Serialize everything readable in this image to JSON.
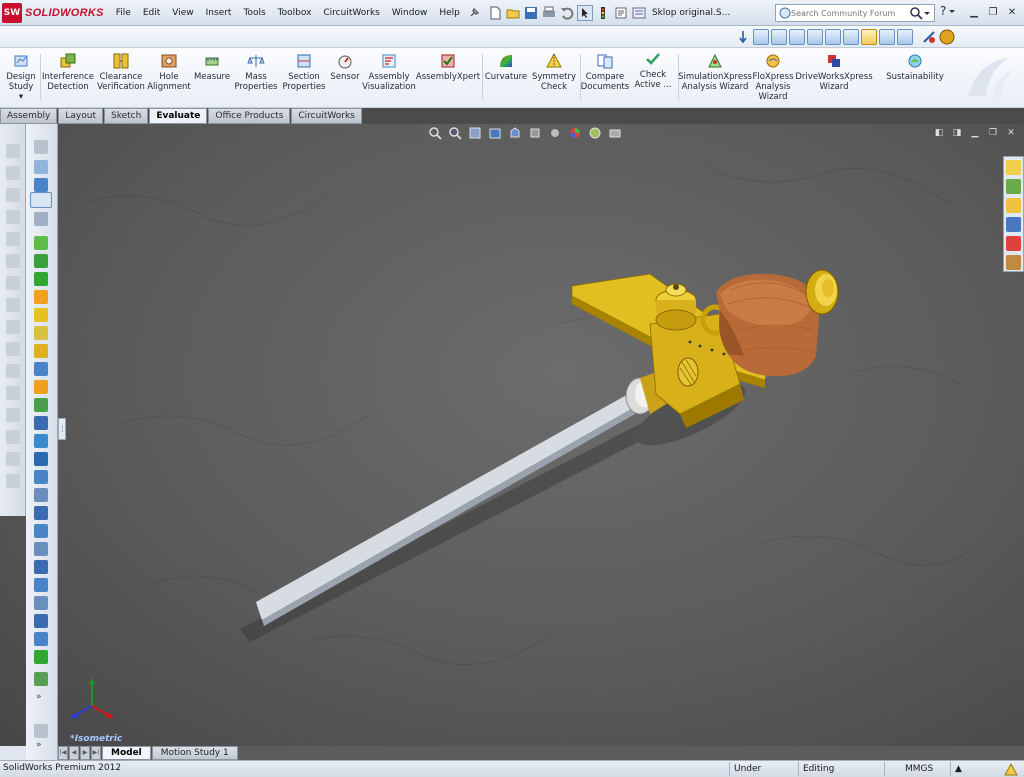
{
  "app": {
    "logo_text": "SOLIDWORKS",
    "document_title": "Sklop original.S..."
  },
  "menu": [
    "File",
    "Edit",
    "View",
    "Insert",
    "Tools",
    "Toolbox",
    "CircuitWorks",
    "Window",
    "Help"
  ],
  "search": {
    "placeholder": "Search Community Forum"
  },
  "help": {
    "label": "?"
  },
  "ribbon": {
    "items": [
      {
        "id": "design-study",
        "label": "Design\nStudy",
        "color": "#3a7bd5"
      },
      {
        "id": "interference-detection",
        "label": "Interference\nDetection",
        "color": "#d8b030"
      },
      {
        "id": "clearance-verification",
        "label": "Clearance\nVerification",
        "color": "#d8b030"
      },
      {
        "id": "hole-alignment",
        "label": "Hole\nAlignment",
        "color": "#c05a2a"
      },
      {
        "id": "measure",
        "label": "Measure",
        "color": "#4a8a4a"
      },
      {
        "id": "mass-properties",
        "label": "Mass\nProperties",
        "color": "#3a6ab0"
      },
      {
        "id": "section-properties",
        "label": "Section\nProperties",
        "color": "#3a6ab0"
      },
      {
        "id": "sensor",
        "label": "Sensor",
        "color": "#555555"
      },
      {
        "id": "assembly-visualization",
        "label": "Assembly\nVisualization",
        "color": "#3a8ad0"
      },
      {
        "id": "assemblyxpert",
        "label": "AssemblyXpert",
        "color": "#d03030"
      },
      {
        "id": "curvature",
        "label": "Curvature",
        "color": "#a040c0"
      },
      {
        "id": "symmetry-check",
        "label": "Symmetry\nCheck",
        "color": "#e0b020"
      },
      {
        "id": "compare-documents",
        "label": "Compare\nDocuments",
        "color": "#3a6ab0"
      },
      {
        "id": "check-active",
        "label": "Check\nActive ...",
        "color": "#30a060"
      },
      {
        "id": "simulationxpress",
        "label": "SimulationXpress\nAnalysis Wizard",
        "color": "#30a060"
      },
      {
        "id": "floxpress",
        "label": "FloXpress\nAnalysis\nWizard",
        "color": "#e09020"
      },
      {
        "id": "driveworksxpress",
        "label": "DriveWorksXpress\nWizard",
        "color": "#c02020"
      },
      {
        "id": "sustainability",
        "label": "Sustainability",
        "color": "#30a0d0"
      }
    ]
  },
  "tabs": [
    {
      "label": "Assembly",
      "active": false
    },
    {
      "label": "Layout",
      "active": false
    },
    {
      "label": "Sketch",
      "active": false
    },
    {
      "label": "Evaluate",
      "active": true
    },
    {
      "label": "Office Products",
      "active": false
    },
    {
      "label": "CircuitWorks",
      "active": false
    }
  ],
  "viewport": {
    "orientation_label": "*Isometric"
  },
  "bottom_tabs": [
    {
      "label": "Model",
      "active": true
    },
    {
      "label": "Motion Study 1",
      "active": false
    }
  ],
  "status": {
    "product": "SolidWorks Premium 2012",
    "definition": "Under Defined",
    "mode": "Editing Assembly",
    "units": "MMGS",
    "units_arrow": "▲"
  }
}
